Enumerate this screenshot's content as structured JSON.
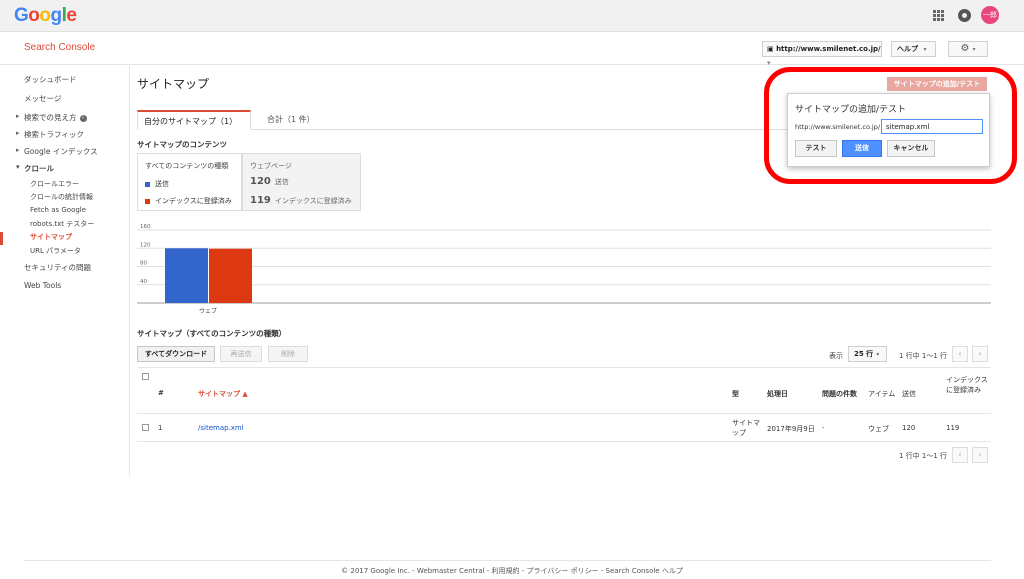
{
  "google_bar": {
    "logo": [
      "G",
      "o",
      "o",
      "g",
      "l",
      "e"
    ],
    "avatar_text": "一郎"
  },
  "header": {
    "app_title": "Search Console",
    "site": "http://www.smilenet.co.jp/",
    "help": "ヘルプ"
  },
  "sidebar": {
    "items": [
      {
        "label": "ダッシュボード"
      },
      {
        "label": "メッセージ"
      },
      {
        "label": "検索での見え方"
      },
      {
        "label": "検索トラフィック"
      },
      {
        "label": "Google インデックス"
      },
      {
        "label": "クロール"
      },
      {
        "label": "セキュリティの問題"
      },
      {
        "label": "Web Tools"
      }
    ],
    "crawl_sub": [
      {
        "label": "クロールエラー"
      },
      {
        "label": "クロールの統計情報"
      },
      {
        "label": "Fetch as Google"
      },
      {
        "label": "robots.txt テスター"
      },
      {
        "label": "サイトマップ"
      },
      {
        "label": "URL パラメータ"
      }
    ]
  },
  "main": {
    "page_title": "サイトマップ",
    "add_test_button": "サイトマップの追加/テスト",
    "tabs": [
      {
        "label": "自分のサイトマップ（1）"
      },
      {
        "label": "合計（1 件）"
      }
    ],
    "contents_label": "サイトマップのコンテンツ",
    "legend": {
      "heading": "すべてのコンテンツの種類",
      "items": [
        {
          "label": "送信",
          "color": "#3366cc"
        },
        {
          "label": "インデックスに登録済み",
          "color": "#dc3912"
        }
      ]
    },
    "stats": {
      "heading": "ウェブページ",
      "rows": [
        {
          "value": "120",
          "label": "送信"
        },
        {
          "value": "119",
          "label": "インデックスに登録済み"
        }
      ]
    },
    "list_label": "サイトマップ（すべてのコンテンツの種類）",
    "buttons": {
      "download_all": "すべてダウンロード",
      "resubmit": "再送信",
      "delete": "削除"
    },
    "display_label": "表示",
    "rows_per_page": "25 行",
    "pager_text": "1 行中 1～1 行",
    "table": {
      "headers": {
        "num": "#",
        "sitemap": "サイトマップ ▲",
        "type": "型",
        "processed": "処理日",
        "issues": "問題の件数",
        "items": "アイテム",
        "submitted": "送信",
        "indexed": "インデックスに登録済み"
      },
      "rows": [
        {
          "num": "1",
          "sitemap": "/sitemap.xml",
          "type": "サイトマップ",
          "processed": "2017年9月9日",
          "issues": "-",
          "items": "ウェブ",
          "submitted": "120",
          "indexed": "119"
        }
      ]
    }
  },
  "chart_data": {
    "type": "bar",
    "categories": [
      "ウェブ"
    ],
    "series": [
      {
        "name": "送信",
        "values": [
          120
        ],
        "color": "#3366cc"
      },
      {
        "name": "インデックスに登録済み",
        "values": [
          119
        ],
        "color": "#dc3912"
      }
    ],
    "yticks": [
      40,
      80,
      120,
      160
    ],
    "ylim": [
      0,
      160
    ],
    "grid": true
  },
  "popup": {
    "title": "サイトマップの追加/テスト",
    "prefix": "http://www.smilenet.co.jp/",
    "input_value": "sitemap.xml",
    "test_button": "テスト",
    "submit_button": "送信",
    "cancel_button": "キャンセル"
  },
  "footer": {
    "text": "© 2017 Google Inc. - Webmaster Central - 利用規約 - プライバシー ポリシー - Search Console ヘルプ"
  },
  "colors": {
    "accent": "#dd4b39",
    "primary_button": "#4d90fe",
    "highlight_ring": "#ff0000",
    "link": "#1155cc"
  }
}
